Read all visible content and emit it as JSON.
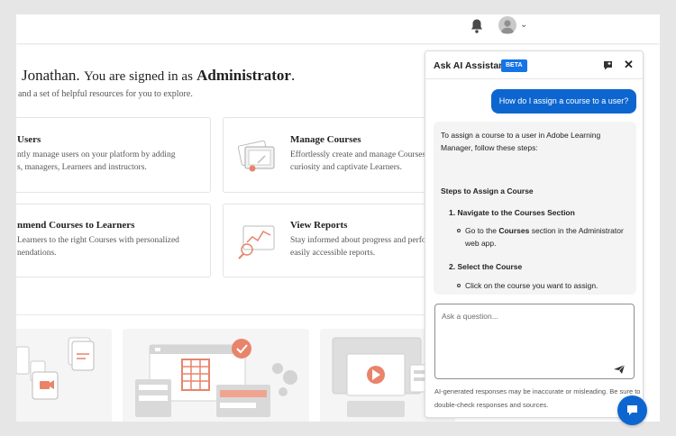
{
  "greeting": {
    "name": "Jonathan.",
    "signed_in_prefix": "You are signed in as",
    "role": "Administrator",
    "subtitle": "and a set of helpful resources for you to explore."
  },
  "cards": [
    {
      "title": "Users",
      "desc1": "ntly manage users on your platform by adding",
      "desc2": "s, managers, Learners and instructors."
    },
    {
      "title": "Manage Courses",
      "desc1": "Effortlessly create and manage Courses",
      "desc2": "curiosity and captivate Learners."
    },
    {
      "title": "nmend Courses to Learners",
      "desc1": "Learners to the right Courses with personalized",
      "desc2": "nendations."
    },
    {
      "title": "View Reports",
      "desc1": "Stay informed about progress and perfo",
      "desc2": "easily accessible reports."
    }
  ],
  "assistant": {
    "title": "Ask AI Assistant",
    "badge": "BETA",
    "user_message": "How do I assign a course to a user?",
    "answer": {
      "intro1": "To assign a course to a user in Adobe Learning",
      "intro2": "Manager, follow these steps:",
      "heading": "Steps to Assign a Course",
      "step1_title": "1. Navigate to the Courses Section",
      "step1_bullet_pre": "Go to the ",
      "step1_bullet_bold": "Courses",
      "step1_bullet_post": " section in the Administrator",
      "step1_bullet_line2": "web app.",
      "step2_title": "2. Select the Course",
      "step2_bullet": "Click on the course you want to assign."
    },
    "input_placeholder": "Ask a question...",
    "disclaimer1": "AI-generated responses may be inaccurate or misleading. Be sure to",
    "disclaimer2": "double-check responses and sources."
  },
  "colors": {
    "accent": "#0d66d0",
    "badge": "#1473e6",
    "illustration": "#e8846b"
  },
  "icons": [
    "bell-icon",
    "avatar",
    "chevron-down-icon",
    "new-chat-icon",
    "close-icon",
    "send-icon",
    "chat-icon"
  ]
}
